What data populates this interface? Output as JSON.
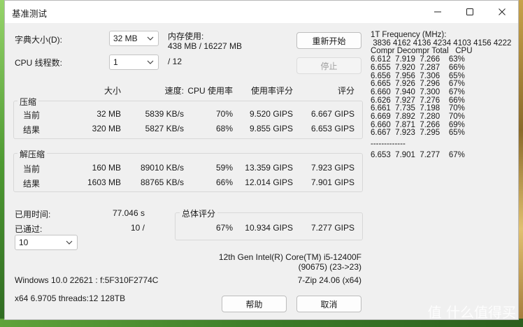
{
  "window": {
    "title": "基准测试"
  },
  "settings": {
    "dict_label": "字典大小(D):",
    "dict_value": "32 MB",
    "threads_label": "CPU 线程数:",
    "threads_value": "1",
    "threads_max": "/ 12",
    "mem_label": "内存使用:",
    "mem_value": "438 MB / 16227 MB"
  },
  "buttons": {
    "restart": "重新开始",
    "stop": "停止",
    "help": "帮助",
    "cancel": "取消"
  },
  "columns": {
    "size": "大小",
    "speed": "速度:",
    "cpu_usage": "CPU 使用率",
    "rating_per_usage": "使用率评分",
    "rating": "评分"
  },
  "compress": {
    "label": "压缩",
    "rows": [
      {
        "name": "当前",
        "size": "32 MB",
        "speed": "5839 KB/s",
        "usage": "70%",
        "rpu": "9.520 GIPS",
        "rating": "6.667 GIPS"
      },
      {
        "name": "结果",
        "size": "320 MB",
        "speed": "5827 KB/s",
        "usage": "68%",
        "rpu": "9.855 GIPS",
        "rating": "6.653 GIPS"
      }
    ]
  },
  "decompress": {
    "label": "解压缩",
    "rows": [
      {
        "name": "当前",
        "size": "160 MB",
        "speed": "89010 KB/s",
        "usage": "59%",
        "rpu": "13.359 GIPS",
        "rating": "7.923 GIPS"
      },
      {
        "name": "结果",
        "size": "1603 MB",
        "speed": "88765 KB/s",
        "usage": "66%",
        "rpu": "12.014 GIPS",
        "rating": "7.901 GIPS"
      }
    ]
  },
  "status": {
    "elapsed_label": "已用时间:",
    "elapsed_value": "77.046 s",
    "passes_label": "已通过:",
    "passes_value": "10 /",
    "passes_select": "10"
  },
  "total": {
    "label": "总体评分",
    "usage": "67%",
    "rpu": "10.934 GIPS",
    "rating": "7.277 GIPS"
  },
  "system": {
    "cpu_name": "12th Gen Intel(R) Core(TM) i5-12400F",
    "cpu_id": "(90675) (23->23)",
    "os": "Windows 10.0 22621 : f:5F310F2774C",
    "version": "7-Zip 24.06 (x64)",
    "arch": "x64 6.9705 threads:12 128TB"
  },
  "freq_panel": {
    "header": "1T Frequency (MHz):",
    "freqs": " 3836 4162 4136 4234 4103 4156 4222",
    "columns": "Compr Decompr Total   CPU",
    "rows": [
      "6.612  7.919  7.266    63%",
      "6.655  7.920  7.287    66%",
      "6.656  7.956  7.306    65%",
      "6.665  7.926  7.296    67%",
      "6.660  7.940  7.300    67%",
      "6.626  7.927  7.276    66%",
      "6.661  7.735  7.198    70%",
      "6.669  7.892  7.280    70%",
      "6.660  7.871  7.266    69%",
      "6.667  7.923  7.295    65%"
    ],
    "separator": "-------------",
    "summary": "6.653  7.901  7.277    67%"
  },
  "watermark": "值 什么值得买"
}
